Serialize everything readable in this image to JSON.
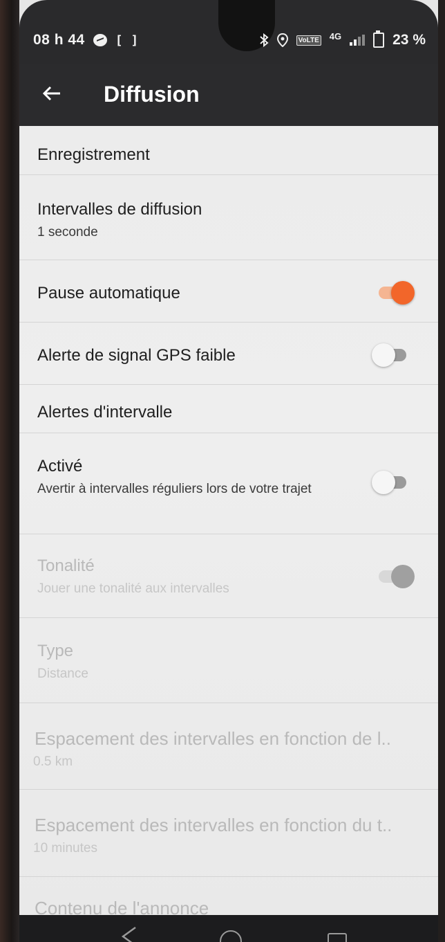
{
  "status_bar": {
    "time": "08 h 44",
    "screen_icon": "[ ]",
    "volte": "VoLTE",
    "network": "4G",
    "battery": "23 %"
  },
  "app_bar": {
    "title": "Diffusion"
  },
  "settings": {
    "section_recording": "Enregistrement",
    "broadcast_interval": {
      "title": "Intervalles de diffusion",
      "value": "1 seconde"
    },
    "auto_pause": {
      "title": "Pause automatique",
      "enabled": true
    },
    "weak_gps_alert": {
      "title": "Alerte de signal GPS faible",
      "enabled": false
    },
    "section_interval_alerts": "Alertes d'intervalle",
    "activated": {
      "title": "Activé",
      "subtitle": "Avertir à intervalles réguliers lors de votre trajet",
      "enabled": false
    },
    "tone": {
      "title": "Tonalité",
      "subtitle": "Jouer une tonalité aux intervalles",
      "enabled": true
    },
    "type": {
      "title": "Type",
      "value": "Distance"
    },
    "distance_spacing": {
      "title": "Espacement des intervalles en fonction de l..",
      "value": "0.5 km"
    },
    "time_spacing": {
      "title": "Espacement des intervalles en fonction du t..",
      "value": "10 minutes"
    },
    "announcement_content": {
      "title": "Contenu de l'annonce"
    }
  },
  "colors": {
    "accent": "#f2662a",
    "accent_track": "#f5b592",
    "app_bar": "#2b2b2d",
    "background": "#ececec"
  }
}
